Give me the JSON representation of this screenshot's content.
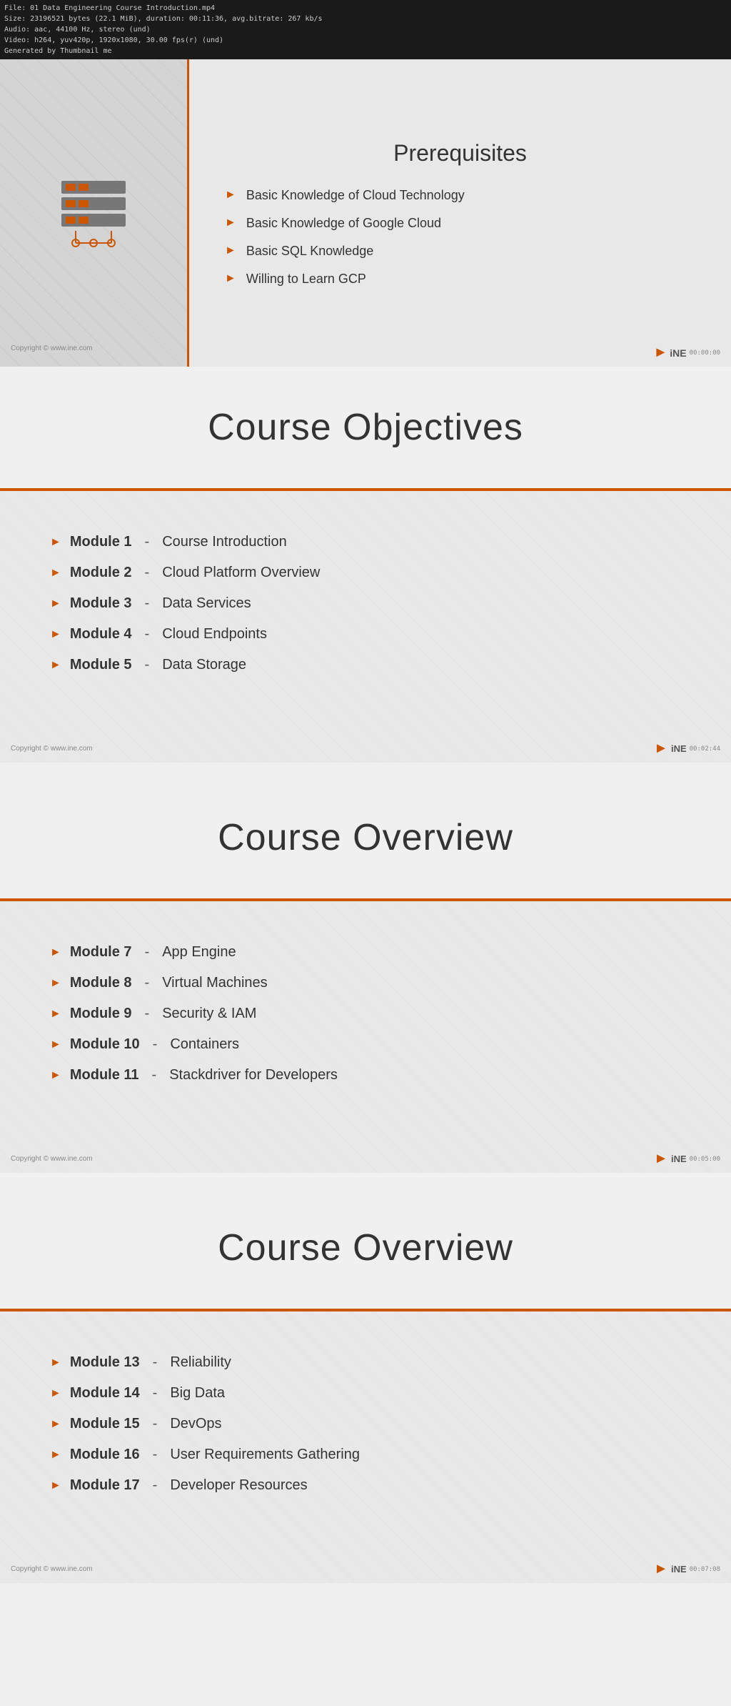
{
  "fileInfo": {
    "line1": "File: 01 Data Engineering Course Introduction.mp4",
    "line2": "Size: 23196521 bytes (22.1 MiB), duration: 00:11:36, avg.bitrate: 267 kb/s",
    "line3": "Audio: aac, 44100 Hz, stereo (und)",
    "line4": "Video: h264, yuv420p, 1920x1080, 30.00 fps(r) (und)",
    "line5": "Generated by Thumbnail me"
  },
  "slide1": {
    "title": "Prerequisites",
    "items": [
      "Basic Knowledge of Cloud Technology",
      "Basic Knowledge of Google Cloud",
      "Basic SQL Knowledge",
      "Willing to Learn GCP"
    ],
    "copyright": "Copyright © www.ine.com",
    "timestamp": "00:00:00"
  },
  "slide2": {
    "title": "Course Objectives",
    "modules": [
      {
        "number": "Module 1",
        "name": "Course Introduction"
      },
      {
        "number": "Module 2",
        "name": "Cloud Platform Overview"
      },
      {
        "number": "Module 3",
        "name": "Data Services"
      },
      {
        "number": "Module 4",
        "name": "Cloud Endpoints"
      },
      {
        "number": "Module 5",
        "name": "Data Storage"
      }
    ],
    "copyright": "Copyright © www.ine.com",
    "timestamp": "00:02:44"
  },
  "slide3": {
    "title": "Course Overview",
    "modules": [
      {
        "number": "Module 7",
        "name": "App Engine"
      },
      {
        "number": "Module 8",
        "name": "Virtual Machines"
      },
      {
        "number": "Module 9",
        "name": "Security & IAM"
      },
      {
        "number": "Module 10",
        "name": "Containers"
      },
      {
        "number": "Module 11",
        "name": "Stackdriver for Developers"
      }
    ],
    "copyright": "Copyright © www.ine.com",
    "timestamp": "00:05:00"
  },
  "slide4": {
    "title": "Course Overview",
    "modules": [
      {
        "number": "Module 13",
        "name": "Reliability"
      },
      {
        "number": "Module 14",
        "name": "Big Data"
      },
      {
        "number": "Module 15",
        "name": "DevOps"
      },
      {
        "number": "Module 16",
        "name": "User Requirements Gathering"
      },
      {
        "number": "Module 17",
        "name": "Developer Resources"
      }
    ],
    "copyright": "Copyright © www.ine.com",
    "timestamp": "00:07:08"
  },
  "icons": {
    "arrow": "&#9658;",
    "iNEmark": "&#x29BF;"
  },
  "colors": {
    "orange": "#cc5500",
    "darkText": "#333",
    "lightText": "#888"
  }
}
